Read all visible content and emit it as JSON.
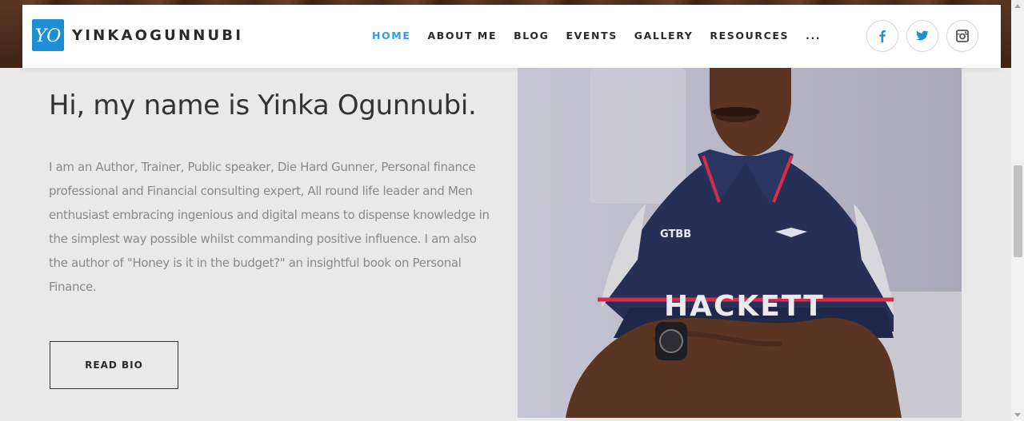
{
  "brand": {
    "name": "YINKAOGUNNUBI",
    "logo_monogram": "YO",
    "accent_color": "#1f8fd3"
  },
  "nav": {
    "items": [
      {
        "label": "HOME",
        "active": true
      },
      {
        "label": "ABOUT ME",
        "active": false
      },
      {
        "label": "BLOG",
        "active": false
      },
      {
        "label": "EVENTS",
        "active": false
      },
      {
        "label": "GALLERY",
        "active": false
      },
      {
        "label": "RESOURCES",
        "active": false
      },
      {
        "label": "...",
        "active": false
      }
    ],
    "active_color": "#3a9ad9"
  },
  "social": {
    "icons": [
      "facebook-icon",
      "twitter-icon",
      "instagram-icon"
    ],
    "icon_color": "#1f8fd3"
  },
  "hero": {
    "headline": "Hi, my name is Yinka Ogunnubi.",
    "bio": "I am an Author, Trainer, Public speaker, Die Hard Gunner, Personal finance professional and Financial consulting expert, All round life leader and Men enthusiast embracing ingenious and digital means to dispense knowledge in the simplest way possible whilst commanding positive influence. I am also the author of \"Honey is it in the budget?\" an insightful book on Personal Finance.",
    "cta_label": "READ BIO"
  }
}
